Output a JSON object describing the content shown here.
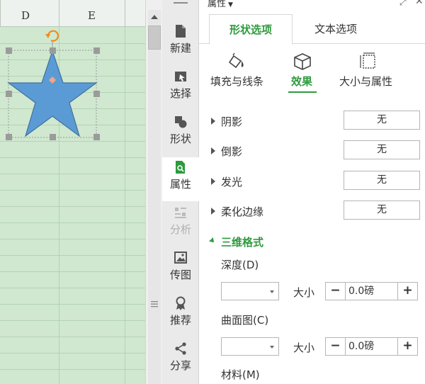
{
  "sheet": {
    "columns": [
      "D",
      "E"
    ],
    "star_fill": "#5b9bd5",
    "star_stroke": "#41719c",
    "rotate_handle_color": "#f08c1e",
    "adjust_handle_color": "#f4a582"
  },
  "toolbar": {
    "items": [
      {
        "label": "新建",
        "icon": "new-doc-icon",
        "state": "normal"
      },
      {
        "label": "选择",
        "icon": "select-icon",
        "state": "normal"
      },
      {
        "label": "形状",
        "icon": "shape-icon",
        "state": "normal"
      },
      {
        "label": "属性",
        "icon": "property-icon",
        "state": "active"
      },
      {
        "label": "分析",
        "icon": "analysis-icon",
        "state": "disabled"
      },
      {
        "label": "传图",
        "icon": "image-icon",
        "state": "normal"
      },
      {
        "label": "推荐",
        "icon": "recommend-icon",
        "state": "normal"
      },
      {
        "label": "分享",
        "icon": "share-icon",
        "state": "normal"
      }
    ]
  },
  "pane": {
    "title": "属性",
    "tabs": [
      {
        "label": "形状选项",
        "active": true
      },
      {
        "label": "文本选项",
        "active": false
      }
    ],
    "subtabs": [
      {
        "label": "填充与线条",
        "icon": "fill-bucket-icon"
      },
      {
        "label": "效果",
        "icon": "cube-icon",
        "active": true
      },
      {
        "label": "大小与属性",
        "icon": "size-frame-icon"
      }
    ],
    "effects": [
      {
        "label": "阴影",
        "value": "无"
      },
      {
        "label": "倒影",
        "value": "无"
      },
      {
        "label": "发光",
        "value": "无"
      },
      {
        "label": "柔化边缘",
        "value": "无"
      }
    ],
    "format3d": {
      "title": "三维格式",
      "depth_label": "深度(D)",
      "bevel_label": "曲面图(C)",
      "material_label": "材料(M)",
      "size_label": "大小",
      "depth_value": "0.0磅",
      "bevel_value": "0.0磅",
      "minus": "−",
      "plus": "+"
    },
    "accent": "#2e9a3e"
  }
}
